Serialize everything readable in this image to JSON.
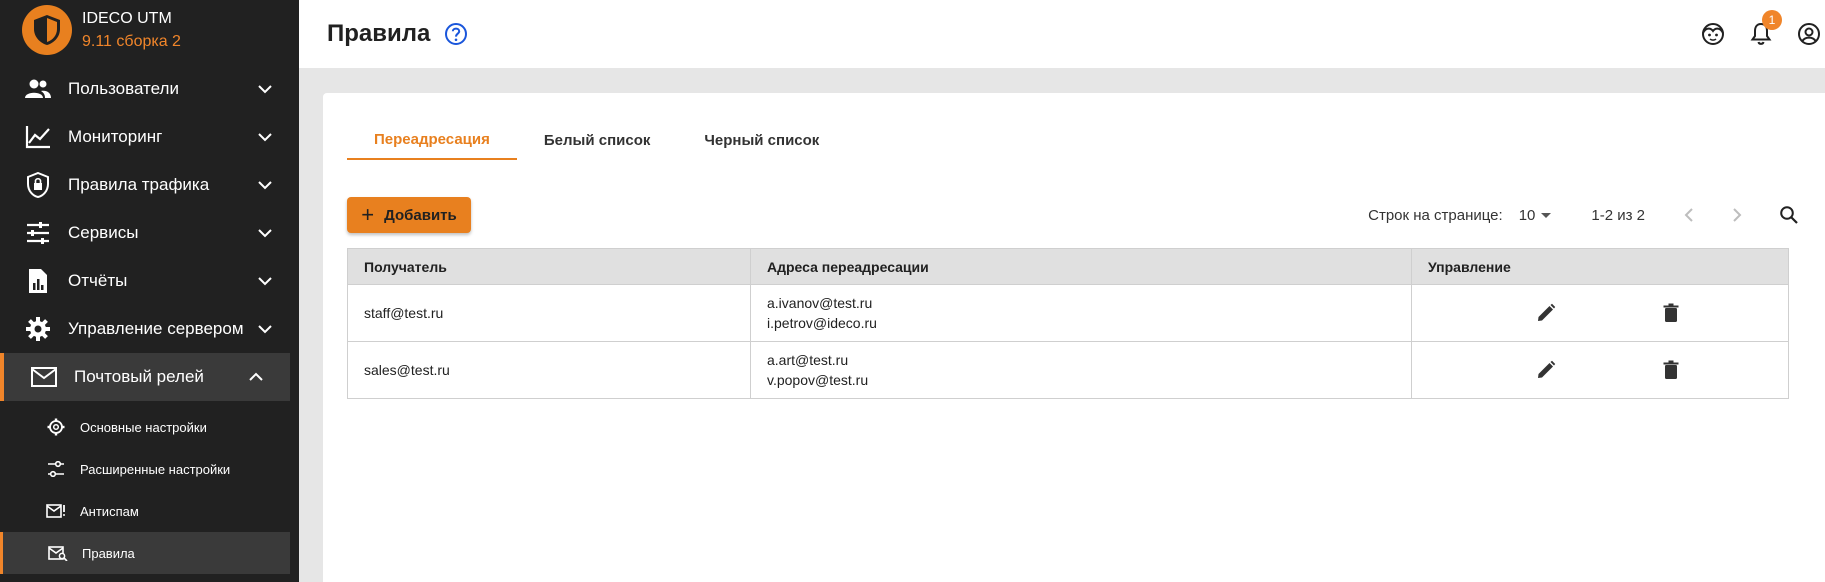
{
  "app": {
    "name": "IDECO UTM",
    "version": "9.11 сборка 2"
  },
  "sidebar": {
    "items": [
      {
        "label": "Пользователи",
        "icon": "users-icon"
      },
      {
        "label": "Мониторинг",
        "icon": "chart-line-icon"
      },
      {
        "label": "Правила трафика",
        "icon": "shield-lock-icon"
      },
      {
        "label": "Сервисы",
        "icon": "tune-icon"
      },
      {
        "label": "Отчёты",
        "icon": "report-icon"
      },
      {
        "label": "Управление сервером",
        "icon": "gear-icon"
      },
      {
        "label": "Почтовый релей",
        "icon": "mail-icon",
        "expanded": true
      }
    ],
    "subitems": [
      {
        "label": "Основные настройки",
        "icon": "gear-icon"
      },
      {
        "label": "Расширенные настройки",
        "icon": "tune-icon"
      },
      {
        "label": "Антиспам",
        "icon": "mail-alert-icon"
      },
      {
        "label": "Правила",
        "icon": "mail-search-icon",
        "active": true
      }
    ]
  },
  "header": {
    "title": "Правила",
    "notifications_count": "1"
  },
  "tabs": [
    {
      "label": "Переадресация",
      "active": true
    },
    {
      "label": "Белый список"
    },
    {
      "label": "Черный список"
    }
  ],
  "toolbar": {
    "add_label": "Добавить"
  },
  "pagination": {
    "rows_label": "Строк на странице:",
    "rows_value": "10",
    "range": "1-2 из 2"
  },
  "table": {
    "headers": [
      "Получатель",
      "Адреса переадресации",
      "Управление"
    ],
    "rows": [
      {
        "recipient": "staff@test.ru",
        "addresses": [
          "a.ivanov@test.ru",
          "i.petrov@ideco.ru"
        ]
      },
      {
        "recipient": "sales@test.ru",
        "addresses": [
          "a.art@test.ru",
          "v.popov@test.ru"
        ]
      }
    ]
  },
  "colors": {
    "accent": "#e8801f",
    "sidebar_bg": "#212121",
    "help_icon": "#1a56db"
  }
}
